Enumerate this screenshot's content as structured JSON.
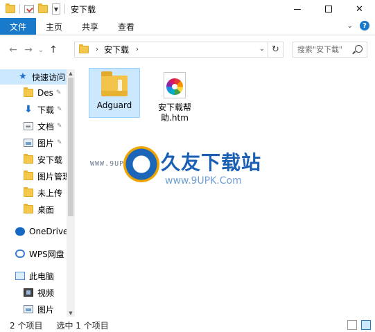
{
  "window": {
    "title": "安下载",
    "minimize_glyph": "—",
    "maximize_glyph": "□",
    "close_glyph": "✕"
  },
  "ribbon": {
    "tabs": [
      "文件",
      "主页",
      "共享",
      "查看"
    ],
    "expand_glyph": "⌄",
    "help_glyph": "?"
  },
  "navigation": {
    "back_glyph": "←",
    "forward_glyph": "→",
    "recent_glyph": "⌄",
    "up_glyph": "↑",
    "crumbs": [
      "安下载"
    ],
    "refresh_glyph": "↻",
    "search_placeholder": "搜索\"安下载\""
  },
  "sidebar": {
    "items": [
      {
        "label": "快速访问",
        "icon": "star-icon",
        "selected": true
      },
      {
        "label": "Des",
        "icon": "folder-icon",
        "pinned": true
      },
      {
        "label": "下载",
        "icon": "download-icon",
        "pinned": true
      },
      {
        "label": "文档",
        "icon": "document-icon",
        "pinned": true
      },
      {
        "label": "图片",
        "icon": "picture-icon",
        "pinned": true
      },
      {
        "label": "安下载",
        "icon": "folder-icon"
      },
      {
        "label": "图片管理",
        "icon": "folder-icon"
      },
      {
        "label": "未上传",
        "icon": "folder-icon"
      },
      {
        "label": "桌面",
        "icon": "folder-icon"
      },
      {
        "label": "OneDrive",
        "icon": "onedrive-icon"
      },
      {
        "label": "WPS网盘",
        "icon": "wps-cloud-icon"
      },
      {
        "label": "此电脑",
        "icon": "computer-icon"
      },
      {
        "label": "视频",
        "icon": "video-icon"
      },
      {
        "label": "图片",
        "icon": "picture-icon"
      }
    ],
    "pin_glyph": "📌"
  },
  "files": [
    {
      "name": "Adguard",
      "type": "folder",
      "selected": true
    },
    {
      "name": "安下载帮助.htm",
      "type": "htm"
    }
  ],
  "watermark": {
    "left_text": "WWW.9UPK.COM",
    "title": "久友下载站",
    "url": "www.9UPK.Com"
  },
  "status": {
    "item_count": "2 个项目",
    "selected": "选中 1 个项目"
  },
  "colors": {
    "accent": "#1979ca",
    "selection": "#cce8ff"
  }
}
